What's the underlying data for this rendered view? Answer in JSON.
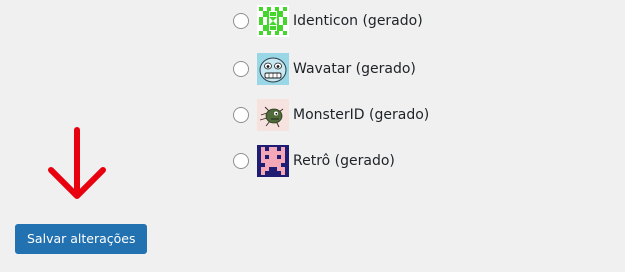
{
  "avatar_options": [
    {
      "label": "Identicon (gerado)",
      "icon": "identicon-avatar-icon"
    },
    {
      "label": "Wavatar (gerado)",
      "icon": "wavatar-avatar-icon"
    },
    {
      "label": "MonsterID (gerado)",
      "icon": "monsterid-avatar-icon"
    },
    {
      "label": "Retrô (gerado)",
      "icon": "retro-avatar-icon"
    }
  ],
  "save_button": {
    "label": "Salvar alterações"
  },
  "colors": {
    "background": "#f0f0f1",
    "button": "#2271b1",
    "arrow": "#e8000f",
    "text": "#1d2327"
  }
}
